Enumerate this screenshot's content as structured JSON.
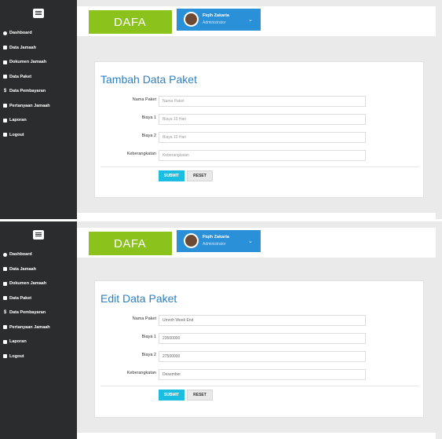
{
  "sidebar": {
    "items": [
      {
        "label": "Dashboard",
        "icon": "dashboard-icon"
      },
      {
        "label": "Data Jamaah",
        "icon": "users-icon"
      },
      {
        "label": "Dokumen Jamaah",
        "icon": "document-icon"
      },
      {
        "label": "Data Paket",
        "icon": "package-icon"
      },
      {
        "label": "Data Pembayaran",
        "icon": "dollar-icon"
      },
      {
        "label": "Pertanyaan Jamaah",
        "icon": "mail-icon"
      },
      {
        "label": "Laporan",
        "icon": "report-icon"
      },
      {
        "label": "Logout",
        "icon": "logout-icon"
      }
    ]
  },
  "header": {
    "brand": "DAFA",
    "user_name": "Fiqih Zakaria",
    "user_role": "Administrator"
  },
  "add_form": {
    "title": "Tambah Data Paket",
    "fields": [
      {
        "label": "Nama Paket",
        "placeholder": "Nama Paket",
        "value": ""
      },
      {
        "label": "Biaya 1",
        "placeholder": "Biaya 10 Hari",
        "value": ""
      },
      {
        "label": "Biaya 2",
        "placeholder": "Biaya 10 Hari",
        "value": ""
      },
      {
        "label": "Keberangkatan",
        "placeholder": "Keberangkatan",
        "value": ""
      }
    ],
    "submit_label": "SUBMIT",
    "reset_label": "RESET"
  },
  "edit_form": {
    "title": "Edit Data Paket",
    "fields": [
      {
        "label": "Nama Paket",
        "value": "Umroh Week End"
      },
      {
        "label": "Biaya 1",
        "value": "23500000"
      },
      {
        "label": "Biaya 2",
        "value": "27500000"
      },
      {
        "label": "Keberangkatan",
        "value": "Desember"
      }
    ],
    "submit_label": "SUBMIT",
    "reset_label": "RESET"
  },
  "colors": {
    "sidebar": "#2a2c2d",
    "brand": "#8bc21c",
    "user_badge": "#2a90d8",
    "title": "#2f7fbf",
    "submit": "#1bbde1"
  }
}
